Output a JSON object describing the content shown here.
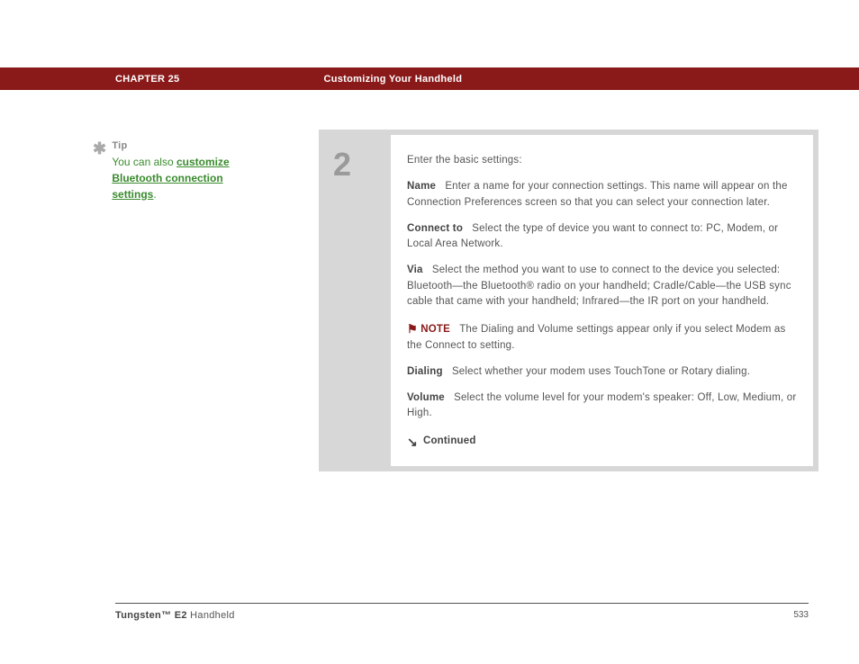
{
  "header": {
    "chapter": "CHAPTER 25",
    "title": "Customizing Your Handheld"
  },
  "tip": {
    "heading": "Tip",
    "prefix": "You can also ",
    "link": "customize Bluetooth connection settings",
    "suffix": "."
  },
  "step": {
    "number": "2",
    "intro": "Enter the basic settings:",
    "name_label": "Name",
    "name_text": "Enter a name for your connection settings. This name will appear on the Connection Preferences screen so that you can select your connection later.",
    "connect_label": "Connect to",
    "connect_text": "Select the type of device you want to connect to: PC, Modem, or Local Area Network.",
    "via_label": "Via",
    "via_text": "Select the method you want to use to connect to the device you selected: Bluetooth—the Bluetooth® radio on your handheld; Cradle/Cable—the USB sync cable that came with your handheld; Infrared—the IR port on your handheld.",
    "note_label": "NOTE",
    "note_text": "The Dialing and Volume settings appear only if you select Modem as the Connect to setting.",
    "dialing_label": "Dialing",
    "dialing_text": "Select whether your modem uses TouchTone or Rotary dialing.",
    "volume_label": "Volume",
    "volume_text": "Select the volume level for your modem's speaker: Off, Low, Medium, or High.",
    "continued": "Continued"
  },
  "footer": {
    "product_bold": "Tungsten™ E2",
    "product_rest": " Handheld",
    "page": "533"
  }
}
